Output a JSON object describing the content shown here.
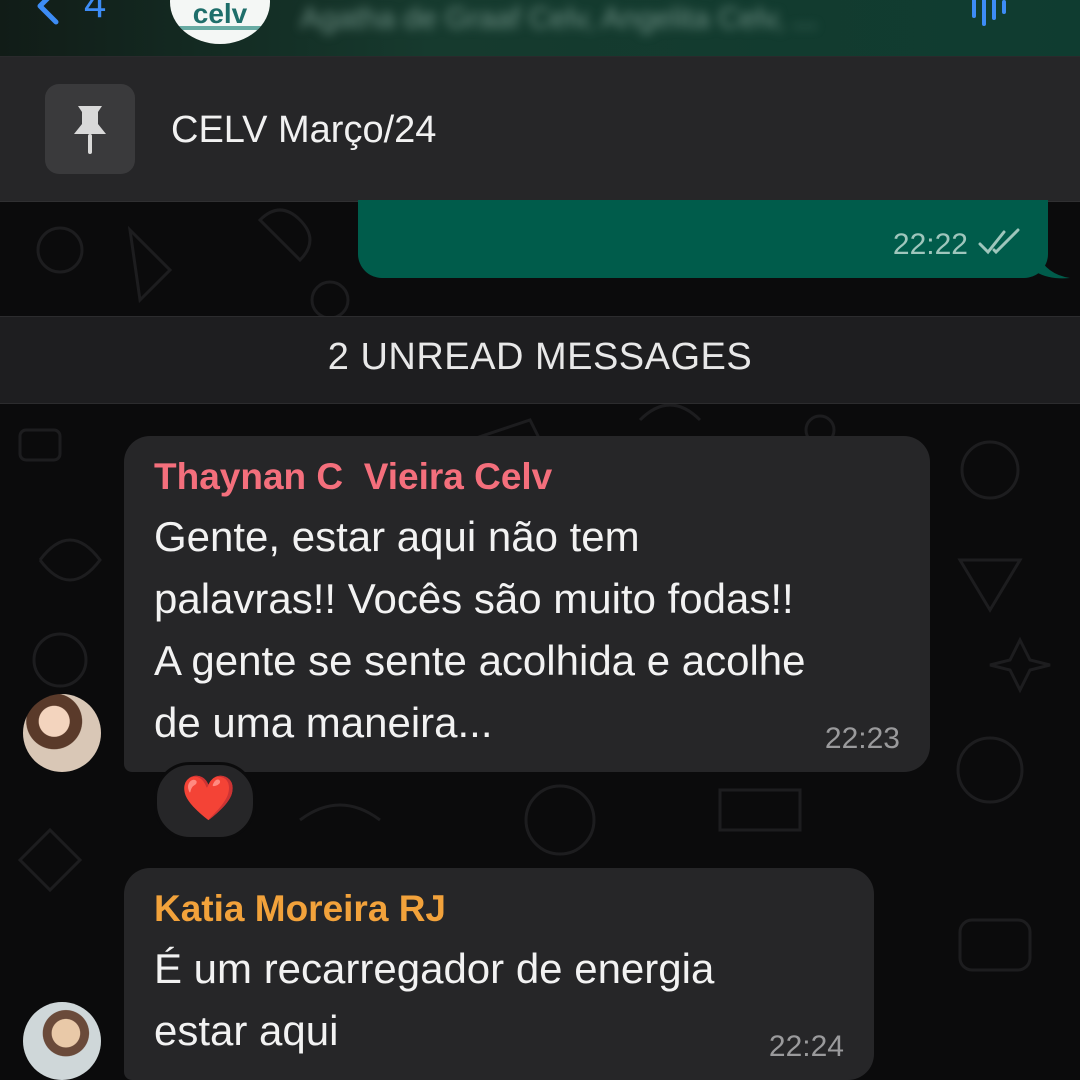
{
  "header": {
    "back_count": "4",
    "group_logo_text": "celv",
    "subtitle": "Agatha de Graaf Celv, Angelita Celv, ..."
  },
  "pinned": {
    "text": "CELV Março/24"
  },
  "outgoing": {
    "time": "22:22"
  },
  "unread_banner": "2 UNREAD MESSAGES",
  "messages": [
    {
      "sender": "Thaynan C  Vieira Celv",
      "lines": [
        "Gente, estar aqui não tem",
        "palavras!! Vocês são muito fodas!!",
        "A gente se sente acolhida e acolhe",
        "de uma maneira..."
      ],
      "time": "22:23",
      "reaction": "❤️"
    },
    {
      "sender": "Katia Moreira RJ",
      "lines": [
        "É um recarregador de energia",
        "estar aqui"
      ],
      "time": "22:24"
    }
  ],
  "colors": {
    "accent_blue": "#3d8cf5",
    "outgoing_bubble": "#005c4b",
    "incoming_bubble": "#262628",
    "sender1": "#f46f7c",
    "sender2": "#f2a23b",
    "reaction": "#ff2d3c"
  },
  "icons": {
    "back": "chevron-left-icon",
    "audio": "audio-wave-icon",
    "pin": "pin-icon",
    "read_receipt": "double-check-icon",
    "reaction": "heart-icon"
  }
}
